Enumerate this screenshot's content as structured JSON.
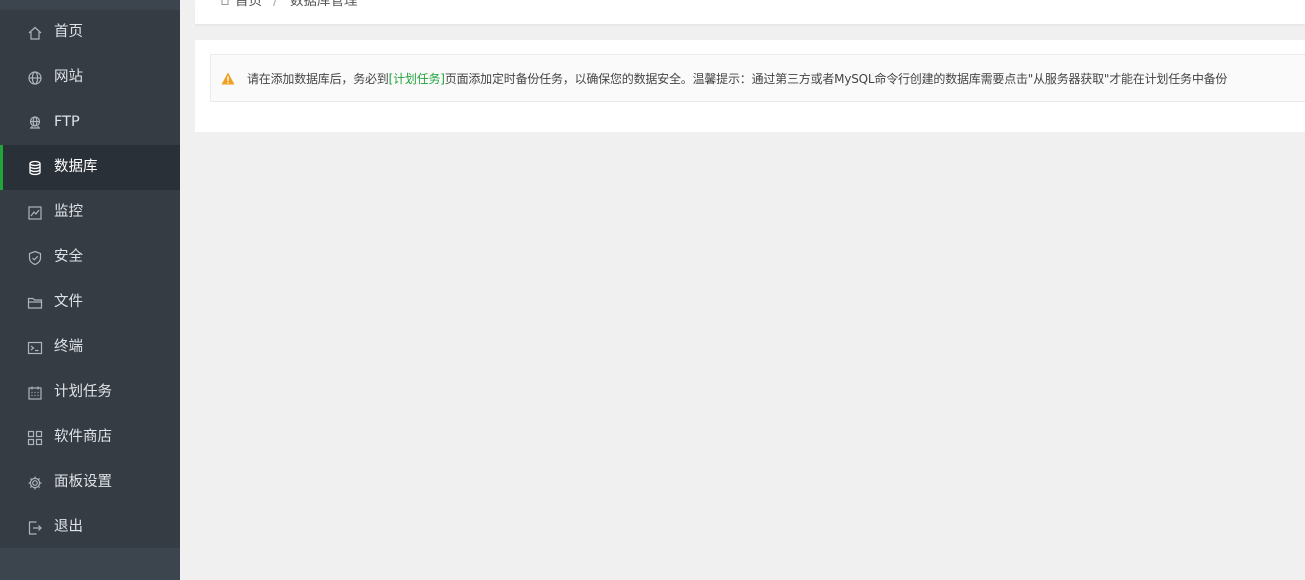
{
  "sidebar": {
    "items": [
      {
        "label": "首页",
        "icon": "home-icon"
      },
      {
        "label": "网站",
        "icon": "globe-icon"
      },
      {
        "label": "FTP",
        "icon": "ftp-icon"
      },
      {
        "label": "数据库",
        "icon": "database-icon",
        "active": true
      },
      {
        "label": "监控",
        "icon": "monitor-icon"
      },
      {
        "label": "安全",
        "icon": "shield-icon"
      },
      {
        "label": "文件",
        "icon": "folder-icon"
      },
      {
        "label": "终端",
        "icon": "terminal-icon"
      },
      {
        "label": "计划任务",
        "icon": "calendar-icon"
      },
      {
        "label": "软件商店",
        "icon": "apps-icon"
      },
      {
        "label": "面板设置",
        "icon": "gear-icon"
      },
      {
        "label": "退出",
        "icon": "logout-icon"
      }
    ]
  },
  "breadcrumb": {
    "home": "首页",
    "separator": "/",
    "current": "数据库管理"
  },
  "alert": {
    "text_before": "请在添加数据库后，务必到",
    "link": "[计划任务]",
    "text_after": "页面添加定时备份任务，以确保您的数据安全。温馨提示：通过第三方或者MySQL命令行创建的数据库需要点击\"从服务器获取\"才能在计划任务中备份"
  },
  "colors": {
    "accent": "#20a53a",
    "sidebar_bg": "#353c44",
    "warning": "#f0a020"
  }
}
